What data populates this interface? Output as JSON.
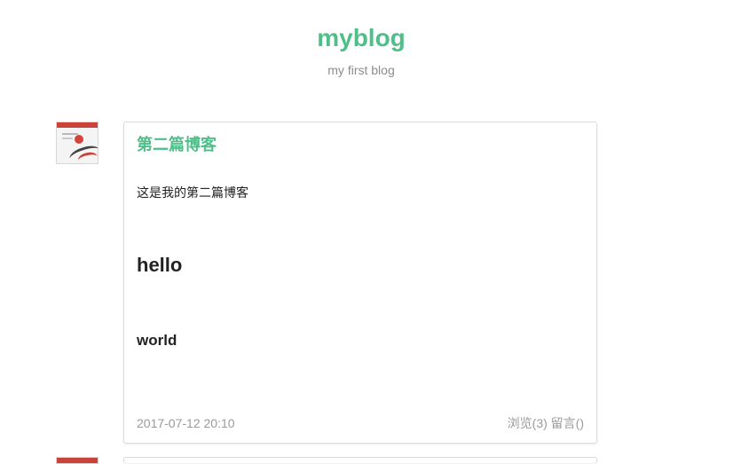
{
  "site": {
    "title": "myblog",
    "subtitle": "my first blog"
  },
  "colors": {
    "accent": "#4fbf8a",
    "muted": "#9a9a9a",
    "text": "#222222",
    "card_border": "#dcdcdc"
  },
  "posts": [
    {
      "avatar_icon": "book-cover-icon",
      "title": "第二篇博客",
      "body_text": "这是我的第二篇博客",
      "heading1": "hello",
      "heading2": "world",
      "date": "2017-07-12 20:10",
      "views_label": "浏览(3)",
      "comments_label": "留言()"
    },
    {
      "avatar_icon": "book-cover-icon"
    }
  ]
}
